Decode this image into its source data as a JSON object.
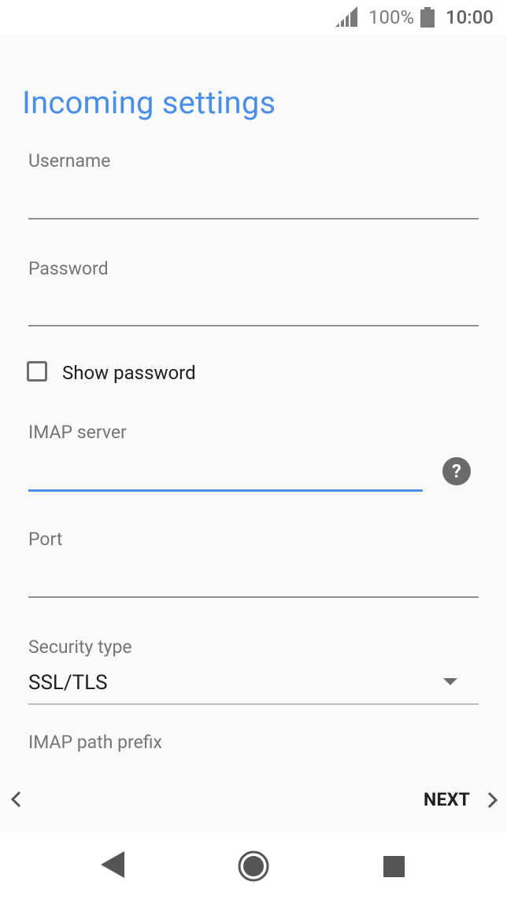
{
  "status_bar": {
    "battery_percent": "100%",
    "time": "10:00",
    "icons": [
      "signal-icon",
      "battery-icon"
    ]
  },
  "page": {
    "title": "Incoming settings"
  },
  "form": {
    "username": {
      "label": "Username",
      "value": ""
    },
    "password": {
      "label": "Password",
      "value": ""
    },
    "show_password": {
      "label": "Show password",
      "checked": false
    },
    "imap_server": {
      "label": "IMAP server",
      "value": "",
      "focused": true,
      "help_icon": "help-icon"
    },
    "port": {
      "label": "Port",
      "value": ""
    },
    "security_type": {
      "label": "Security type",
      "selected": "SSL/TLS"
    },
    "imap_path_prefix": {
      "label": "IMAP path prefix"
    }
  },
  "bottom_nav": {
    "next_label": "NEXT"
  },
  "colors": {
    "accent": "#4a8ee8",
    "background": "#fafafa"
  }
}
